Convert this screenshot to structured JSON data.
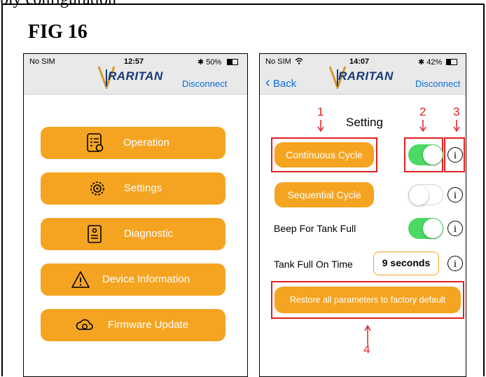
{
  "caption_top": "bly configuration",
  "figure": {
    "title": "FIG 16"
  },
  "left_phone": {
    "status": {
      "carrier": "No SIM",
      "time": "12:57",
      "battery": "✱ 50%"
    },
    "header": {
      "logo": "RARITAN",
      "disconnect": "Disconnect"
    },
    "menu": [
      {
        "label": "Operation",
        "icon": "operation-checklist-icon"
      },
      {
        "label": "Settings",
        "icon": "settings-gear-icon"
      },
      {
        "label": "Diagnostic",
        "icon": "diagnostic-document-icon"
      },
      {
        "label": "Device Information",
        "icon": "warning-triangle-icon"
      },
      {
        "label": "Firmware Update",
        "icon": "cloud-refresh-icon"
      }
    ]
  },
  "right_phone": {
    "status": {
      "carrier": "No SIM",
      "time": "14:07",
      "battery": "✱ 42%"
    },
    "header": {
      "back": "Back",
      "logo": "RARITAN",
      "disconnect": "Disconnect"
    },
    "title": "Setting",
    "rows": {
      "continuous": {
        "label": "Continuous Cycle",
        "on": true
      },
      "sequential": {
        "label": "Sequential Cycle",
        "on": false
      },
      "beep": {
        "label": "Beep For Tank Full",
        "on": true
      },
      "tank_time": {
        "label": "Tank Full On Time",
        "value": "9 seconds"
      }
    },
    "info_glyph": "i",
    "restore": "Restore all parameters to factory default",
    "annotations": [
      "1",
      "2",
      "3",
      "4"
    ],
    "annotation_color": "#e02020"
  },
  "colors": {
    "accent": "#f5a422",
    "toggle_on": "#4cd964",
    "link": "#0a6fd6"
  }
}
